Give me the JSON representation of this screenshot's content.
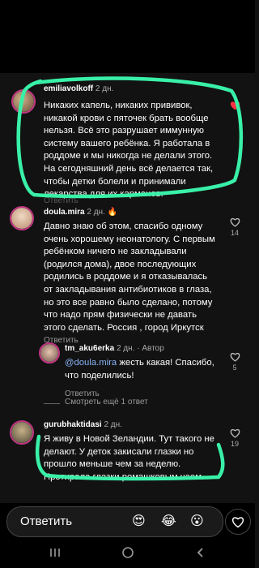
{
  "comments": [
    {
      "username": "emiliavolkoff",
      "time": "2 дн.",
      "text": "Никаких капель, никаких прививок,\nникакой крови с пяточек брать вообще\nнельзя.  Всё это разрушает иммунную\nсистему вашего ребёнка. Я работала в\nроддоме и мы никогда не делали этого.\nНа сегодняшний день всё делается так,\nчтобы детки болели и принимали\nлекарства для их карманов.",
      "reply_label": "Ответить"
    },
    {
      "username": "doula.mira",
      "time": "2 дн.",
      "text": "Давно знаю об этом, спасибо одному\nочень хорошему неонатологу. С первым\nребёнком ничего не закладывали\n(родился дома), двое последующих\nродились в роддоме и я отказывалась\nот закладывания антибиотиков в глаза,\nно это все равно было сделано, потому\nчто надо прям физически не давать\nэтого сделать. Россия , город Иркутск",
      "reply_label": "Ответить",
      "likes": "14"
    },
    {
      "username": "tm_aku6erka",
      "time": "2 дн.",
      "author_badge": "Автор",
      "mention": "@doula.mira",
      "text_after_mention": " жесть какая! Спасибо,\nчто поделились!",
      "reply_label": "Ответить",
      "likes": "5"
    },
    {
      "username": "gurubhaktidasi",
      "time": "2 дн.",
      "text": "Я живу в Новой Зеландии. Тут такого не\nделают. У деток закисали глазки но\nпрошло меньше чем за неделю.\nПротирала глазки ромашковым чаем.",
      "likes": "19"
    }
  ],
  "view_replies": "Смотреть ещё 1 ответ",
  "composer": {
    "placeholder": "Ответить",
    "emojis": [
      "😍",
      "😂",
      "😮"
    ]
  },
  "colors": {
    "highlight": "#39f0a8",
    "liked_heart": "#ff3040",
    "story_ring": "#c13584"
  },
  "icons": {
    "like": "heart-icon",
    "flame_badge": "flame-emoji",
    "nav": [
      "recent-apps-icon",
      "home-icon",
      "back-icon"
    ]
  }
}
